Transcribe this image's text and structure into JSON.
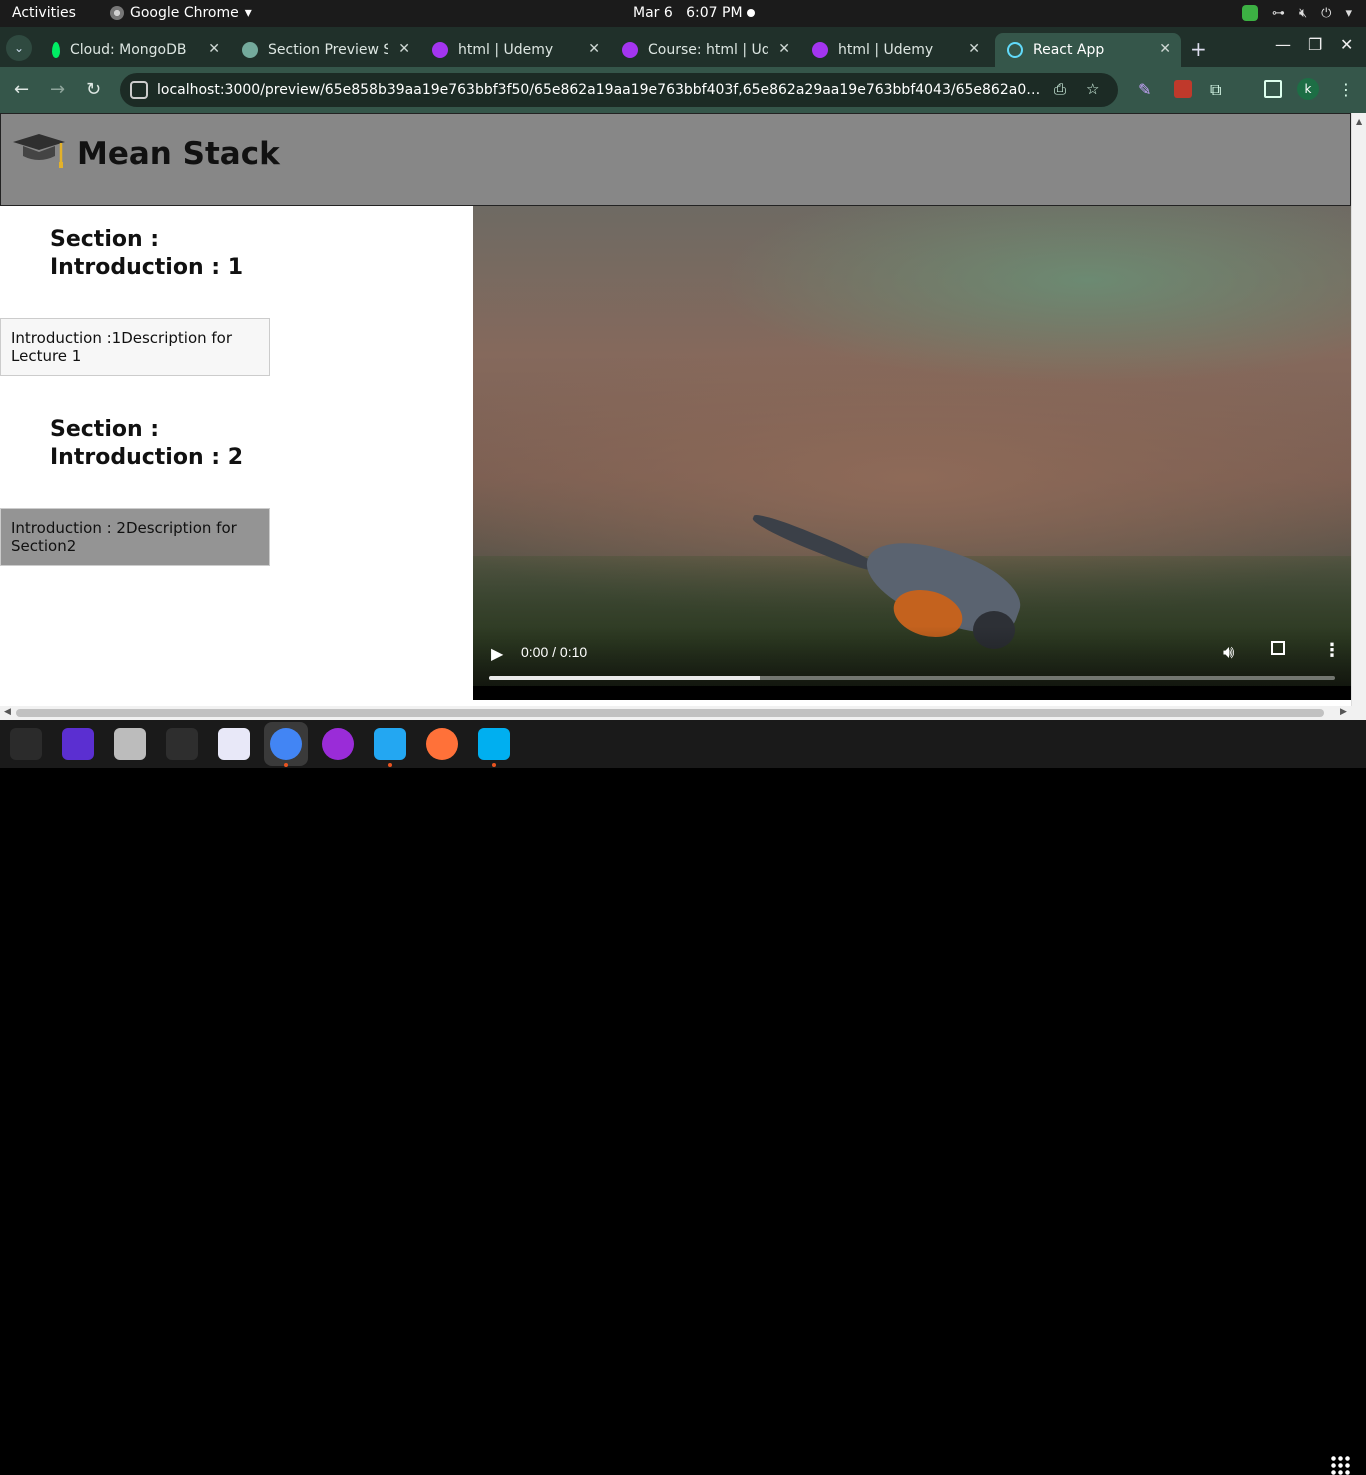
{
  "system": {
    "activities": "Activities",
    "app_name": "Google Chrome",
    "date": "Mar 6",
    "time": "6:07 PM"
  },
  "tabs": [
    {
      "label": "Cloud: MongoDB",
      "icon": "mongodb-leaf-icon",
      "color": "#00ed64"
    },
    {
      "label": "Section Preview S",
      "icon": "openai-icon",
      "color": "#74aa9c"
    },
    {
      "label": "html | Udemy",
      "icon": "udemy-icon",
      "color": "#a435f0"
    },
    {
      "label": "Course: html | Ud",
      "icon": "udemy-icon",
      "color": "#a435f0"
    },
    {
      "label": "html | Udemy",
      "icon": "udemy-icon",
      "color": "#a435f0"
    },
    {
      "label": "React App",
      "icon": "react-icon",
      "color": "#61dafb",
      "active": true
    }
  ],
  "omnibox": {
    "url": "localhost:3000/preview/65e858b39aa19e763bbf3f50/65e862a19aa19e763bbf403f,65e862a29aa19e763bbf4043/65e862a09aa19e763bbf..."
  },
  "profile": {
    "initial": "k"
  },
  "page": {
    "brand": "Mean Stack",
    "sections": [
      {
        "title": "Section : Introduction : 1",
        "lecture": "Introduction :1Description for Lecture 1"
      },
      {
        "title": "Section : Introduction : 2",
        "lecture": "Introduction : 2Description for Section2"
      }
    ],
    "video": {
      "time": "0:00 / 0:10",
      "buffered_fraction": 0.32
    }
  },
  "colors": {
    "header_bg": "#878787",
    "lecture_selected_bg": "#949494",
    "chrome_frame": "#35564a"
  },
  "dock": [
    {
      "name": "system-monitor-icon",
      "color": "#2b2b2b"
    },
    {
      "name": "screen-recorder-icon",
      "color": "#5b2fd1"
    },
    {
      "name": "files-icon",
      "color": "#bcbcbc"
    },
    {
      "name": "terminal-icon",
      "color": "#2e2e2e"
    },
    {
      "name": "text-editor-icon",
      "color": "#e8e8f8"
    },
    {
      "name": "chrome-icon",
      "color": "#4285f4"
    },
    {
      "name": "firefox-dev-icon",
      "color": "#9a2cd8"
    },
    {
      "name": "vscode-icon",
      "color": "#23a7f2"
    },
    {
      "name": "firefox-icon",
      "color": "#ff7139"
    },
    {
      "name": "skype-icon",
      "color": "#00aff0"
    }
  ]
}
